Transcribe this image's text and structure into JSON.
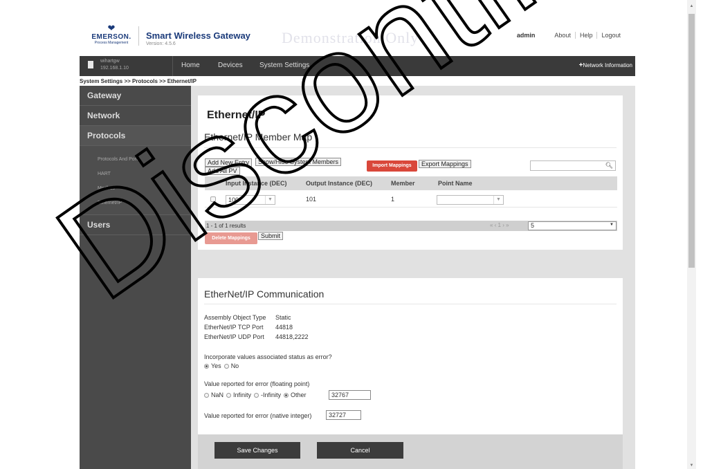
{
  "header": {
    "logo_word": "EMERSON.",
    "logo_sub": "Process Management",
    "product_title": "Smart Wireless Gateway",
    "version": "Version: 4.5.6",
    "demo_text": "Demonstration Only",
    "user": "admin",
    "links": [
      "About",
      "Help",
      "Logout"
    ]
  },
  "navbar": {
    "device_name": "wihartgw",
    "device_ip": "192.168.1.10",
    "items": [
      "Home",
      "Devices",
      "System Settings"
    ],
    "network_info": "Network Information"
  },
  "breadcrumb": "System Settings >> Protocols >> Ethernet/IP",
  "sidebar": {
    "gateway": "Gateway",
    "network": "Network",
    "protocols": "Protocols",
    "protocol_items": [
      "Protocols And Ports",
      "HART",
      "Modbus",
      "Ethernet/IP"
    ],
    "users": "Users"
  },
  "member_map": {
    "page_title": "Ethernet/IP",
    "section_title": "Ethernet/IP Member Map",
    "add_new_entry": "Add New Entry",
    "show_hide": "Show/Hide System Members",
    "add_all_pv": "Add All PV",
    "import_mappings": "Import Mappings",
    "export_mappings": "Export Mappings",
    "search_value": "",
    "columns": [
      "Input Instance (DEC)",
      "Output Instance (DEC)",
      "Member",
      "Point Name"
    ],
    "rows": [
      {
        "input": "100",
        "output": "101",
        "member": "1",
        "point_name": ""
      }
    ],
    "results_text": "1 - 1 of 1 results",
    "pager": "« ‹ 1 › »",
    "page_size": "5",
    "delete_mappings": "Delete Mappings",
    "submit": "Submit"
  },
  "communication": {
    "title": "EtherNet/IP Communication",
    "assembly_label": "Assembly Object Type",
    "assembly_value": "Static",
    "tcp_label": "EtherNet/IP TCP Port",
    "tcp_value": "44818",
    "udp_label": "EtherNet/IP UDP Port",
    "udp_value": "44818,2222",
    "incorporate_q": "Incorporate values associated status as error?",
    "yes": "Yes",
    "no": "No",
    "float_label": "Value reported for error (floating point)",
    "float_opts": [
      "NaN",
      "Infinity",
      "-Infinity",
      "Other"
    ],
    "float_value": "32767",
    "native_label": "Value reported for error (native integer)",
    "native_value": "32727"
  },
  "footer": {
    "save": "Save Changes",
    "cancel": "Cancel"
  },
  "watermark": "Discontinued"
}
